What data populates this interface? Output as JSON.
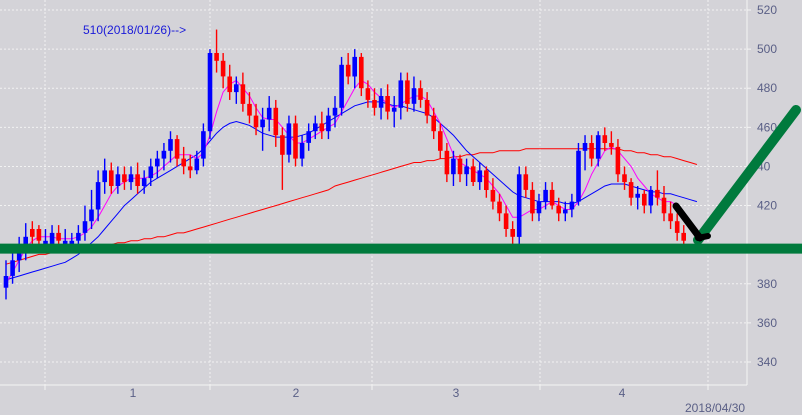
{
  "chart_data": {
    "type": "candlestick",
    "title": "",
    "xlabel": "",
    "ylabel": "",
    "ylim": [
      330,
      525
    ],
    "y_ticks": [
      340,
      360,
      380,
      400,
      420,
      440,
      460,
      480,
      500,
      520
    ],
    "y_tick_labels": [
      "340",
      "360",
      "380",
      "",
      "420",
      "40",
      "460",
      "480",
      "500",
      "520"
    ],
    "x_tick_labels": [
      "1",
      "2",
      "3",
      "4"
    ],
    "end_date_label": "2018/04/30",
    "annotation": {
      "text": "510(2018/01/26)-->",
      "value": 510,
      "date": "2018/01/26"
    },
    "colors": {
      "up": "#ff0000",
      "down": "#0000ff",
      "ma_short": "#ff00ff",
      "ma_mid": "#0000ff",
      "ma_long": "#ff0000",
      "drawn_line": "#007a3d",
      "drawn_arrow": "#000000",
      "background": "#d4d3d8",
      "grid": "#f2f2f2"
    },
    "candles": [
      [
        378,
        392,
        372,
        384,
        "up"
      ],
      [
        384,
        396,
        380,
        392,
        "up"
      ],
      [
        392,
        404,
        386,
        398,
        "up"
      ],
      [
        398,
        411,
        392,
        404,
        "up"
      ],
      [
        404,
        412,
        398,
        408,
        "down"
      ],
      [
        408,
        410,
        400,
        402,
        "down"
      ],
      [
        402,
        408,
        396,
        398,
        "up"
      ],
      [
        398,
        410,
        396,
        406,
        "up"
      ],
      [
        406,
        410,
        400,
        402,
        "down"
      ],
      [
        402,
        408,
        396,
        398,
        "up"
      ],
      [
        398,
        406,
        398,
        402,
        "up"
      ],
      [
        402,
        410,
        398,
        406,
        "up"
      ],
      [
        406,
        420,
        402,
        412,
        "up"
      ],
      [
        412,
        428,
        408,
        418,
        "up"
      ],
      [
        418,
        438,
        412,
        432,
        "up"
      ],
      [
        432,
        444,
        426,
        438,
        "up"
      ],
      [
        438,
        442,
        426,
        430,
        "down"
      ],
      [
        430,
        440,
        426,
        436,
        "up"
      ],
      [
        436,
        440,
        428,
        432,
        "down"
      ],
      [
        432,
        440,
        428,
        436,
        "up"
      ],
      [
        436,
        442,
        426,
        430,
        "down"
      ],
      [
        430,
        438,
        426,
        434,
        "up"
      ],
      [
        434,
        444,
        430,
        440,
        "up"
      ],
      [
        440,
        448,
        434,
        444,
        "up"
      ],
      [
        444,
        452,
        438,
        448,
        "up"
      ],
      [
        448,
        458,
        442,
        454,
        "up"
      ],
      [
        454,
        456,
        440,
        444,
        "down"
      ],
      [
        444,
        450,
        436,
        440,
        "down"
      ],
      [
        440,
        446,
        434,
        438,
        "down"
      ],
      [
        438,
        448,
        436,
        444,
        "up"
      ],
      [
        444,
        462,
        440,
        458,
        "up"
      ],
      [
        458,
        500,
        454,
        498,
        "up"
      ],
      [
        498,
        510,
        488,
        494,
        "down"
      ],
      [
        494,
        498,
        480,
        486,
        "down"
      ],
      [
        486,
        492,
        474,
        478,
        "down"
      ],
      [
        478,
        486,
        472,
        482,
        "up"
      ],
      [
        482,
        488,
        468,
        472,
        "down"
      ],
      [
        472,
        478,
        462,
        466,
        "down"
      ],
      [
        466,
        472,
        456,
        460,
        "down"
      ],
      [
        460,
        470,
        448,
        464,
        "up"
      ],
      [
        464,
        476,
        458,
        470,
        "up"
      ],
      [
        470,
        474,
        450,
        456,
        "down"
      ],
      [
        456,
        460,
        428,
        446,
        "down"
      ],
      [
        446,
        466,
        442,
        462,
        "up"
      ],
      [
        462,
        466,
        440,
        444,
        "down"
      ],
      [
        444,
        456,
        440,
        452,
        "up"
      ],
      [
        452,
        462,
        448,
        458,
        "up"
      ],
      [
        458,
        466,
        454,
        462,
        "up"
      ],
      [
        462,
        468,
        454,
        458,
        "down"
      ],
      [
        458,
        470,
        454,
        466,
        "up"
      ],
      [
        466,
        476,
        460,
        470,
        "up"
      ],
      [
        470,
        496,
        466,
        492,
        "up"
      ],
      [
        492,
        498,
        482,
        486,
        "down"
      ],
      [
        486,
        500,
        480,
        496,
        "up"
      ],
      [
        496,
        498,
        476,
        480,
        "down"
      ],
      [
        480,
        484,
        470,
        474,
        "down"
      ],
      [
        474,
        480,
        466,
        470,
        "down"
      ],
      [
        470,
        480,
        464,
        476,
        "up"
      ],
      [
        476,
        482,
        464,
        468,
        "down"
      ],
      [
        468,
        476,
        460,
        470,
        "up"
      ],
      [
        470,
        488,
        464,
        484,
        "up"
      ],
      [
        484,
        488,
        468,
        472,
        "down"
      ],
      [
        472,
        486,
        468,
        480,
        "up"
      ],
      [
        480,
        484,
        470,
        474,
        "down"
      ],
      [
        474,
        478,
        462,
        466,
        "down"
      ],
      [
        466,
        470,
        454,
        458,
        "down"
      ],
      [
        458,
        462,
        444,
        448,
        "down"
      ],
      [
        448,
        452,
        432,
        436,
        "down"
      ],
      [
        436,
        448,
        430,
        444,
        "up"
      ],
      [
        444,
        446,
        432,
        436,
        "down"
      ],
      [
        436,
        444,
        430,
        440,
        "up"
      ],
      [
        440,
        444,
        430,
        432,
        "down"
      ],
      [
        432,
        442,
        428,
        438,
        "up"
      ],
      [
        438,
        440,
        424,
        428,
        "down"
      ],
      [
        428,
        434,
        418,
        422,
        "down"
      ],
      [
        422,
        426,
        412,
        416,
        "down"
      ],
      [
        416,
        420,
        404,
        408,
        "down"
      ],
      [
        408,
        412,
        400,
        404,
        "down"
      ],
      [
        404,
        440,
        398,
        436,
        "up"
      ],
      [
        436,
        440,
        424,
        428,
        "down"
      ],
      [
        428,
        432,
        412,
        416,
        "down"
      ],
      [
        416,
        426,
        412,
        422,
        "up"
      ],
      [
        422,
        432,
        418,
        428,
        "up"
      ],
      [
        428,
        432,
        418,
        420,
        "down"
      ],
      [
        420,
        424,
        412,
        416,
        "down"
      ],
      [
        416,
        422,
        412,
        418,
        "up"
      ],
      [
        418,
        426,
        414,
        422,
        "up"
      ],
      [
        422,
        452,
        420,
        448,
        "up"
      ],
      [
        448,
        456,
        438,
        452,
        "up"
      ],
      [
        452,
        456,
        440,
        444,
        "down"
      ],
      [
        444,
        458,
        440,
        456,
        "up"
      ],
      [
        456,
        460,
        448,
        452,
        "down"
      ],
      [
        452,
        458,
        446,
        450,
        "down"
      ],
      [
        450,
        454,
        432,
        436,
        "down"
      ],
      [
        436,
        440,
        428,
        432,
        "down"
      ],
      [
        432,
        434,
        420,
        424,
        "down"
      ],
      [
        424,
        430,
        418,
        426,
        "up"
      ],
      [
        426,
        428,
        416,
        420,
        "down"
      ],
      [
        420,
        430,
        416,
        428,
        "up"
      ],
      [
        428,
        438,
        420,
        424,
        "down"
      ],
      [
        424,
        430,
        412,
        416,
        "down"
      ],
      [
        416,
        422,
        408,
        412,
        "down"
      ],
      [
        412,
        416,
        402,
        406,
        "down"
      ],
      [
        406,
        410,
        398,
        402,
        "down"
      ]
    ],
    "ma_short": [
      380,
      386,
      392,
      398,
      402,
      404,
      404,
      404,
      403,
      403,
      403,
      404,
      406,
      409,
      414,
      420,
      426,
      430,
      432,
      434,
      434,
      434,
      435,
      437,
      440,
      443,
      446,
      446,
      446,
      444,
      447,
      456,
      468,
      478,
      482,
      484,
      480,
      476,
      470,
      465,
      464,
      464,
      460,
      456,
      452,
      452,
      454,
      456,
      458,
      460,
      462,
      468,
      474,
      480,
      484,
      482,
      478,
      475,
      472,
      470,
      472,
      474,
      476,
      476,
      474,
      468,
      462,
      454,
      446,
      442,
      440,
      438,
      436,
      434,
      430,
      426,
      420,
      414,
      414,
      416,
      418,
      418,
      420,
      422,
      420,
      418,
      418,
      422,
      428,
      436,
      442,
      448,
      450,
      448,
      444,
      440,
      434,
      430,
      426,
      424,
      422,
      422,
      420,
      416,
      412,
      408
    ],
    "ma_mid": [
      382,
      383,
      384,
      385,
      386,
      387,
      388,
      389,
      390,
      391,
      393,
      395,
      398,
      401,
      404,
      408,
      412,
      416,
      420,
      423,
      426,
      429,
      432,
      434,
      436,
      438,
      440,
      442,
      444,
      446,
      449,
      453,
      457,
      460,
      462,
      463,
      462,
      461,
      459,
      457,
      456,
      455,
      455,
      455,
      455,
      456,
      457,
      459,
      461,
      463,
      465,
      467,
      469,
      471,
      472,
      473,
      473,
      473,
      472,
      471,
      471,
      470,
      469,
      468,
      467,
      465,
      462,
      459,
      456,
      452,
      448,
      445,
      442,
      439,
      436,
      433,
      430,
      427,
      425,
      424,
      423,
      422,
      422,
      422,
      422,
      421,
      421,
      422,
      424,
      426,
      428,
      430,
      431,
      431,
      431,
      430,
      429,
      428,
      427,
      427,
      426,
      426,
      425,
      424,
      423,
      422
    ],
    "ma_long": [
      390,
      391,
      392,
      393,
      394,
      395,
      395,
      396,
      396,
      397,
      397,
      398,
      398,
      399,
      399,
      400,
      400,
      401,
      401,
      402,
      402,
      403,
      403,
      404,
      404,
      405,
      406,
      406,
      407,
      408,
      409,
      410,
      411,
      412,
      413,
      414,
      415,
      416,
      417,
      418,
      419,
      420,
      421,
      422,
      423,
      424,
      425,
      426,
      427,
      428,
      430,
      431,
      432,
      433,
      434,
      435,
      436,
      437,
      438,
      439,
      440,
      441,
      442,
      442,
      443,
      443,
      444,
      444,
      445,
      445,
      446,
      446,
      447,
      447,
      447,
      448,
      448,
      448,
      448,
      449,
      449,
      449,
      449,
      449,
      449,
      449,
      449,
      449,
      449,
      449,
      449,
      449,
      449,
      449,
      448,
      448,
      447,
      447,
      446,
      446,
      445,
      445,
      444,
      443,
      442,
      441
    ],
    "drawn": {
      "support_level": 398,
      "trend_up": [
        [
          698,
          240
        ],
        [
          796,
          110
        ]
      ],
      "down_arrow": [
        [
          676,
          206
        ],
        [
          700,
          238
        ]
      ]
    }
  }
}
